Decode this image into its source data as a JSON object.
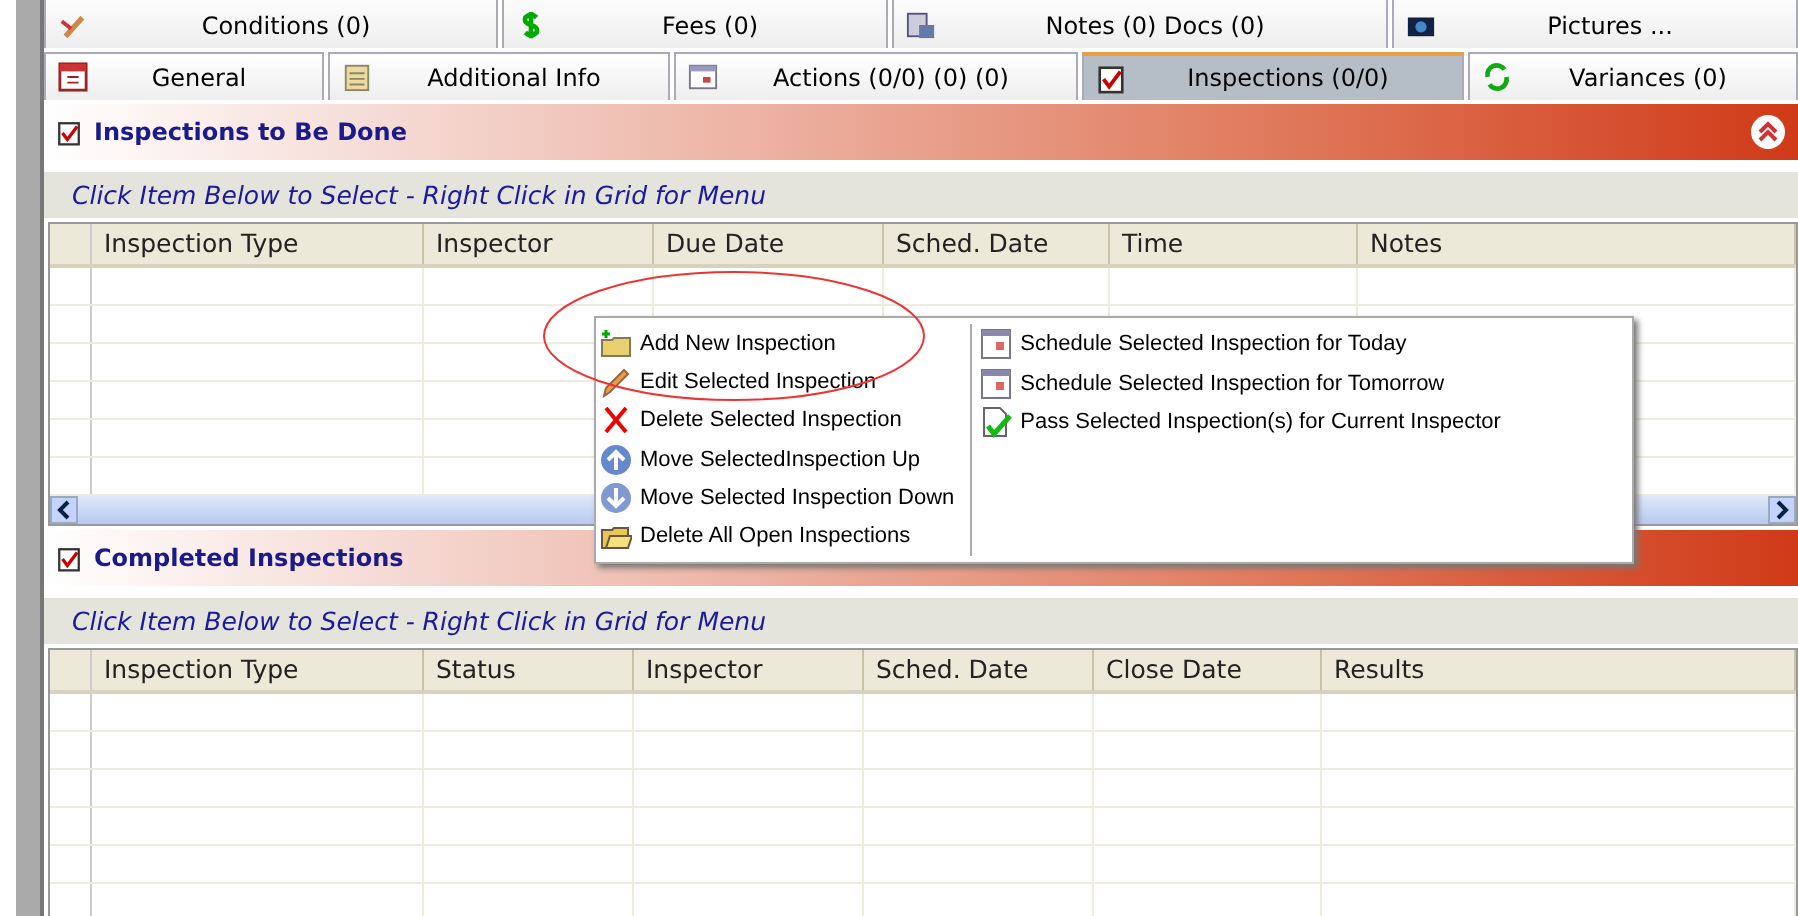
{
  "tabs_top": [
    {
      "label": "Conditions (0)",
      "kind": "pencil",
      "selected": false
    },
    {
      "label": "Fees (0)",
      "kind": "dollar",
      "selected": false
    },
    {
      "label": "Notes (0) Docs (0)",
      "kind": "notes",
      "selected": false
    },
    {
      "label": "Pictures ...",
      "kind": "camera",
      "selected": false
    }
  ],
  "tabs": [
    {
      "label": "General",
      "kind": "calendar",
      "selected": false
    },
    {
      "label": "Additional Info",
      "kind": "clipboard",
      "selected": false
    },
    {
      "label": "Actions (0/0) (0) (0)",
      "kind": "window",
      "selected": false
    },
    {
      "label": "Inspections (0/0)",
      "kind": "check",
      "selected": true
    },
    {
      "label": "Variances (0)",
      "kind": "refresh",
      "selected": false
    }
  ],
  "panels": [
    {
      "title": "Inspections to Be Done",
      "collapsible": true,
      "hint": "Click Item Below to Select - Right Click in Grid for Menu",
      "columns": [
        "Inspection Type",
        "Inspector",
        "Due Date",
        "Sched. Date",
        "Time",
        "Notes"
      ],
      "scrollbar": true
    },
    {
      "title": "Completed Inspections",
      "collapsible": false,
      "hint": "Click Item Below to Select - Right Click in Grid for Menu",
      "columns": [
        "Inspection Type",
        "Status",
        "Inspector",
        "Sched. Date",
        "Close Date",
        "Results"
      ],
      "scrollbar": false
    }
  ],
  "context_menu": {
    "columns": [
      [
        {
          "label": "Add New Inspection",
          "kind": "add"
        },
        {
          "label": "Edit Selected Inspection",
          "kind": "edit"
        },
        {
          "label": "Delete Selected Inspection",
          "kind": "delete"
        },
        {
          "label": "Move SelectedInspection Up",
          "kind": "up"
        },
        {
          "label": "Move Selected Inspection Down",
          "kind": "down"
        },
        {
          "label": "Delete All Open Inspections",
          "kind": "folder"
        }
      ],
      [
        {
          "label": "Schedule Selected Inspection for Today",
          "kind": "calendar"
        },
        {
          "label": "Schedule Selected Inspection for Tomorrow",
          "kind": "calendar"
        },
        {
          "label": "Pass Selected Inspection(s) for Current Inspector",
          "kind": "pass"
        }
      ]
    ]
  }
}
